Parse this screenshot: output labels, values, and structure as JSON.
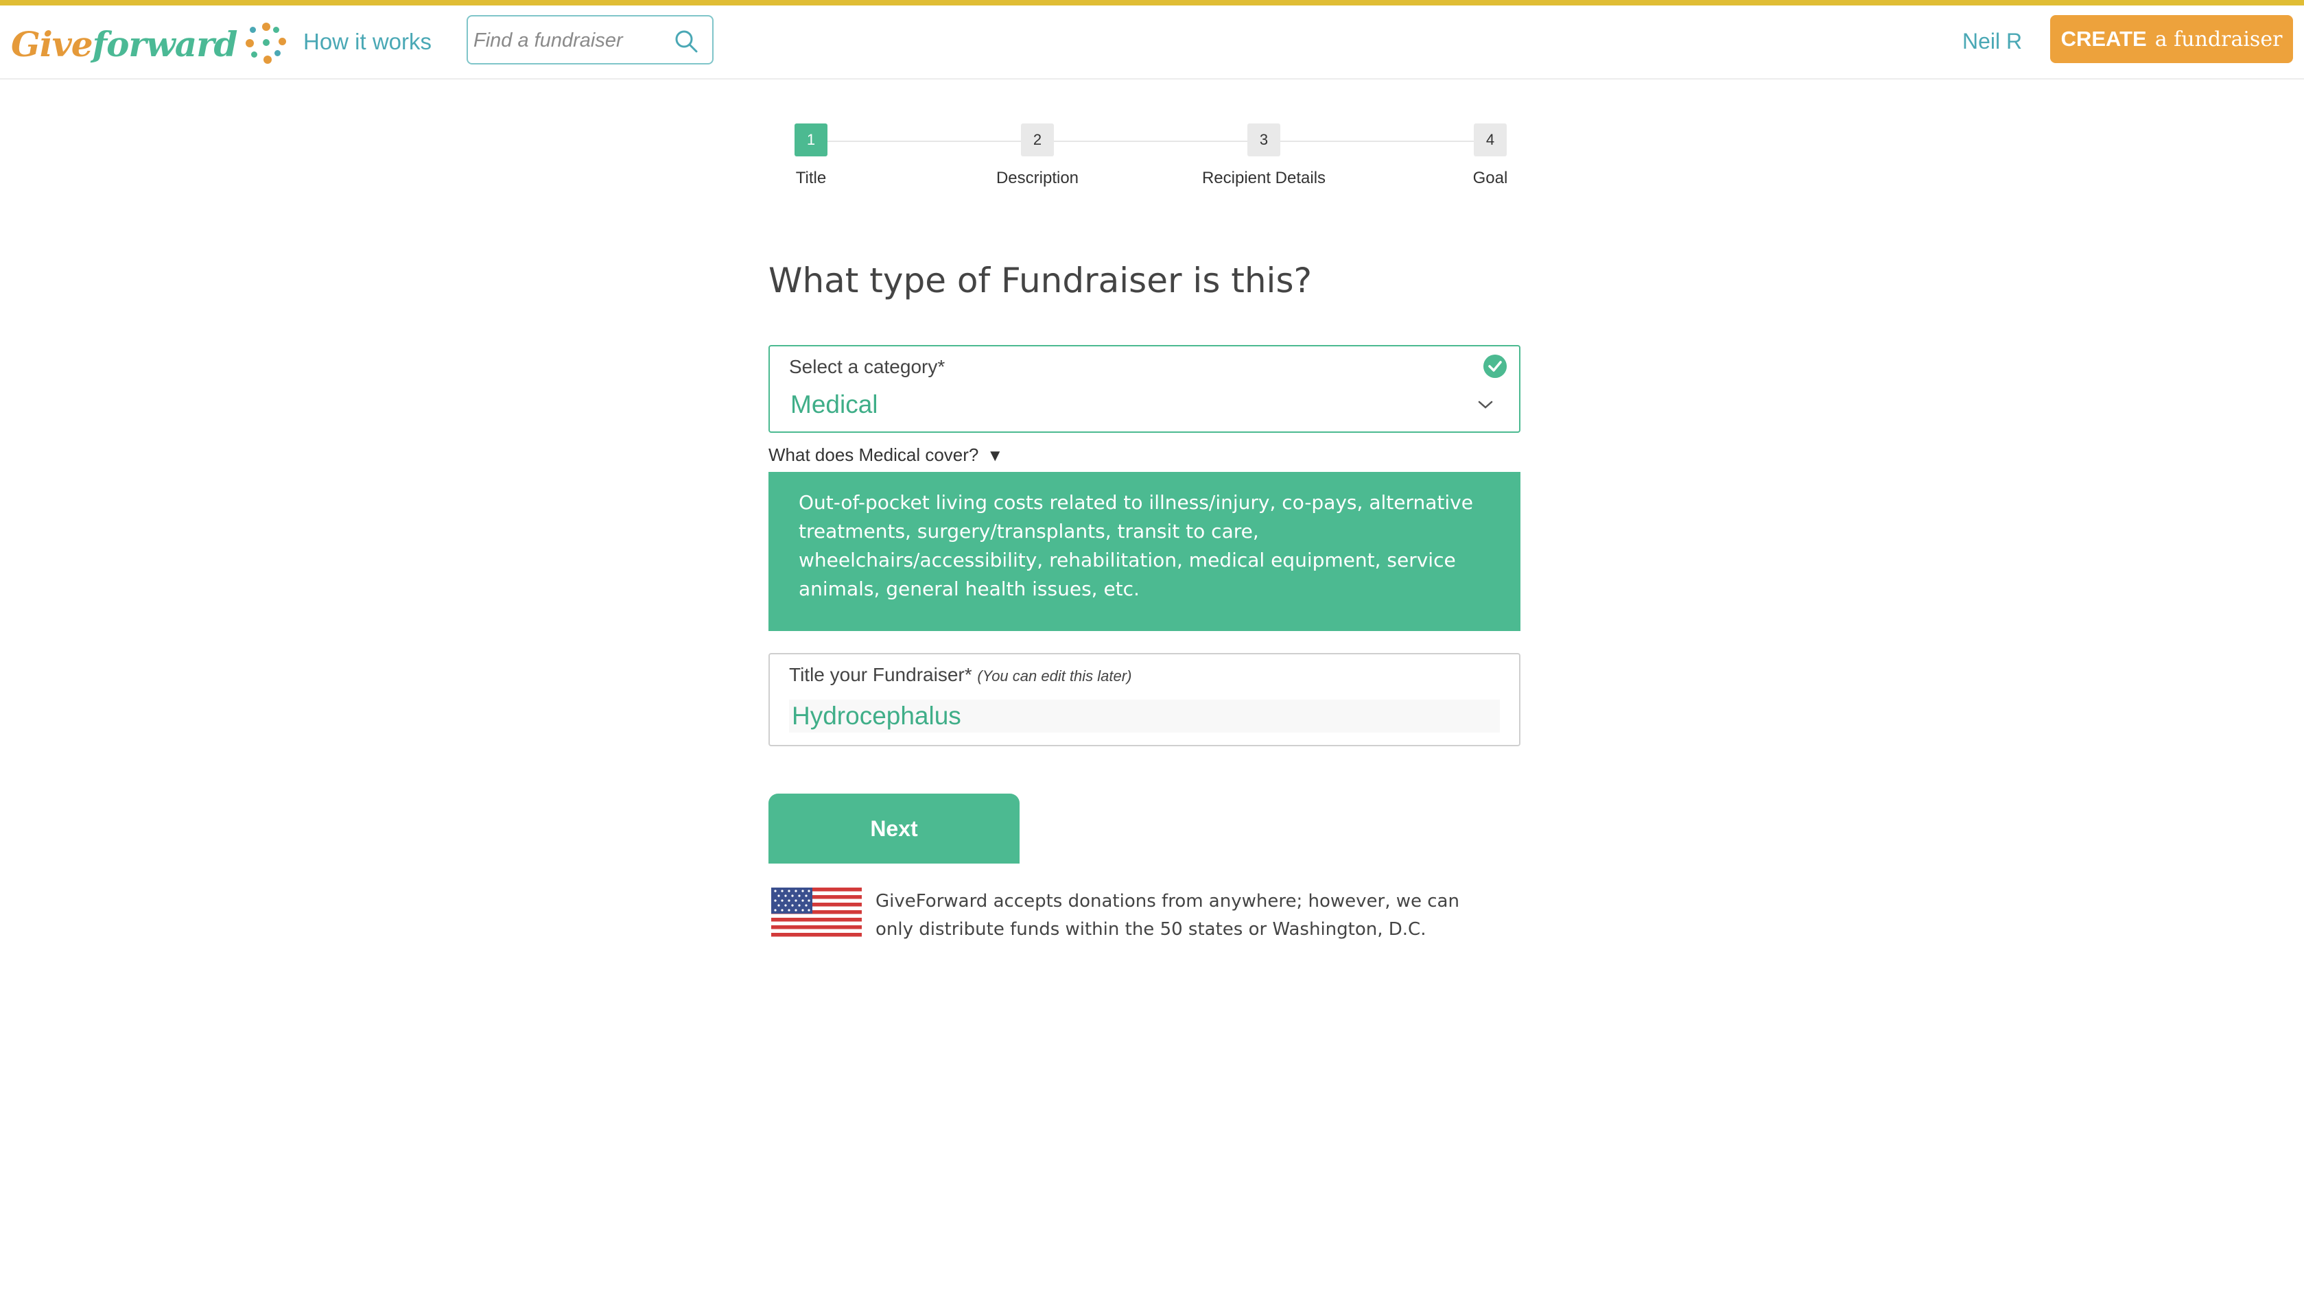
{
  "header": {
    "logo_text_a": "Give",
    "logo_text_b": "forward",
    "nav_how": "How it works",
    "search_placeholder": "Find a fundraiser",
    "user_name": "Neil R",
    "create_a": "CREATE",
    "create_b": "a fundraiser"
  },
  "colors": {
    "accent_green": "#4cba91",
    "accent_orange": "#eda23c",
    "accent_teal": "#4aa8b5",
    "top_bar": "#e0bd35"
  },
  "steps": [
    {
      "num": "1",
      "label": "Title",
      "active": true
    },
    {
      "num": "2",
      "label": "Description",
      "active": false
    },
    {
      "num": "3",
      "label": "Recipient Details",
      "active": false
    },
    {
      "num": "4",
      "label": "Goal",
      "active": false
    }
  ],
  "form": {
    "question": "What type of Fundraiser is this?",
    "category_label": "Select a category*",
    "category_value": "Medical",
    "cover_question": "What does Medical cover?",
    "cover_arrow": "▼",
    "cover_text": "Out-of-pocket living costs related to illness/injury, co-pays, alternative treatments, surgery/transplants, transit to care, wheelchairs/accessibility, rehabilitation, medical equipment, service animals, general health issues, etc.",
    "title_label": "Title your Fundraiser*",
    "title_hint": "(You can edit this later)",
    "title_value": "Hydrocephalus",
    "next_label": "Next"
  },
  "notice": {
    "text": "GiveForward accepts donations from anywhere; however, we can only distribute funds within the 50 states or Washington, D.C."
  }
}
